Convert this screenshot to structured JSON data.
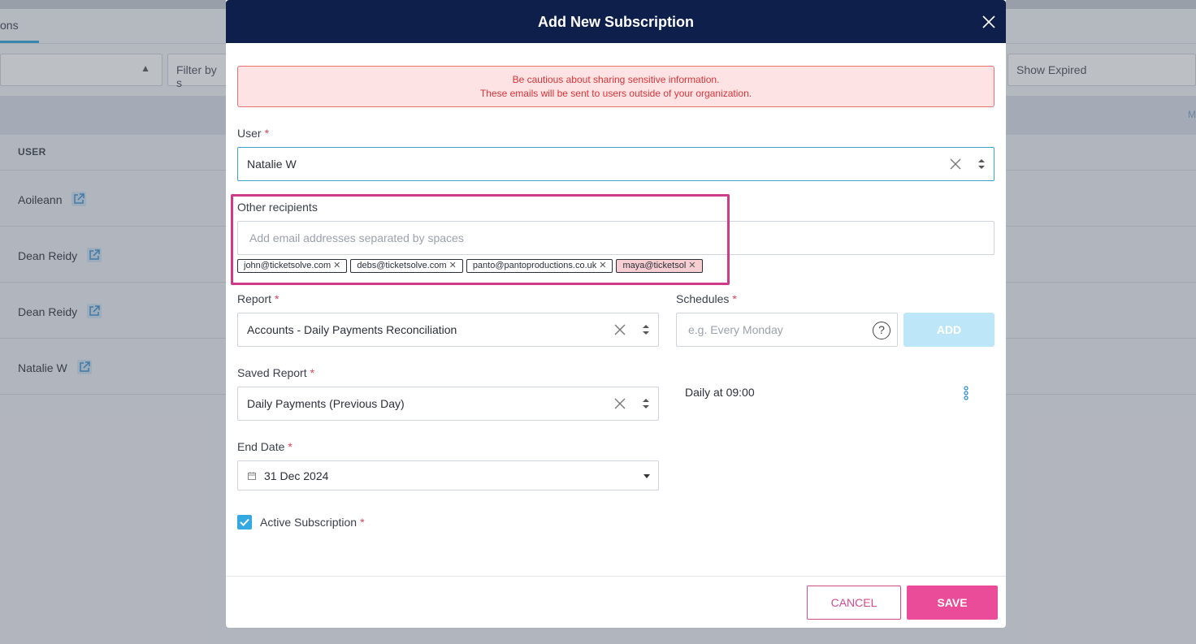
{
  "background": {
    "tab_label": "ons",
    "filter_placeholder": "Filter by s",
    "show_expired": "Show Expired",
    "band_text": "M",
    "table_header_user": "USER",
    "rows": [
      "Aoileann",
      "Dean Reidy",
      "Dean Reidy",
      "Natalie W"
    ]
  },
  "modal": {
    "title": "Add New Subscription",
    "warning_line1": "Be cautious about sharing sensitive information.",
    "warning_line2": "These emails will be sent to users outside of your organization.",
    "user_label": "User",
    "user_value": "Natalie W",
    "other_recipients_label": "Other recipients",
    "other_recipients_placeholder": "Add email addresses separated by spaces",
    "recipients": [
      {
        "email": "john@ticketsolve.com",
        "valid": true
      },
      {
        "email": "debs@ticketsolve.com",
        "valid": true
      },
      {
        "email": "panto@pantoproductions.co.uk",
        "valid": true
      },
      {
        "email": "maya@ticketsol",
        "valid": false
      }
    ],
    "report_label": "Report",
    "report_value": "Accounts - Daily Payments Reconciliation",
    "schedules_label": "Schedules",
    "schedules_placeholder": "e.g. Every Monday",
    "help_glyph": "?",
    "add_label": "ADD",
    "saved_report_label": "Saved Report",
    "saved_report_value": "Daily Payments (Previous Day)",
    "schedule_item": "Daily at 09:00",
    "end_date_label": "End Date",
    "end_date_value": "31 Dec 2024",
    "active_label": "Active Subscription",
    "required_marker": "*",
    "cancel_label": "CANCEL",
    "save_label": "SAVE"
  },
  "colors": {
    "header": "#0f1f4b",
    "accent_pink": "#ea4c9a",
    "accent_blue": "#34a8e0",
    "warning_text": "#d8343a"
  }
}
